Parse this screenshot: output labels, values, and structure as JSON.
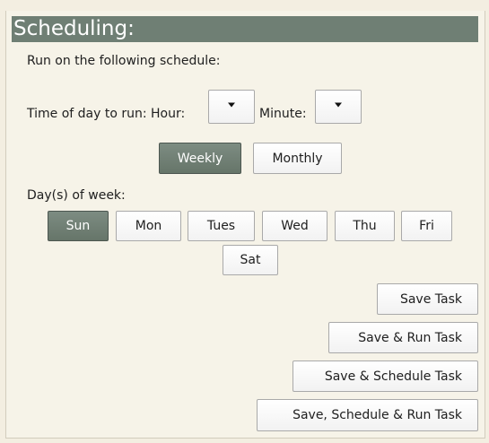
{
  "section": {
    "title": "Scheduling:",
    "intro": "Run on the following schedule:"
  },
  "time": {
    "label": "Time of day to run: Hour:",
    "minute_label": "Minute:",
    "hour_value": "",
    "minute_value": ""
  },
  "frequency": {
    "options": [
      "Weekly",
      "Monthly"
    ],
    "selected": "Weekly"
  },
  "days": {
    "label": "Day(s) of week:",
    "items": [
      "Sun",
      "Mon",
      "Tues",
      "Wed",
      "Thu",
      "Fri",
      "Sat"
    ],
    "selected": [
      "Sun"
    ]
  },
  "actions": {
    "save": "Save Task",
    "save_run": "Save & Run Task",
    "save_schedule": "Save & Schedule Task",
    "save_schedule_run": "Save, Schedule & Run Task"
  },
  "icons": {
    "dropdown": "chevron-down-icon"
  }
}
